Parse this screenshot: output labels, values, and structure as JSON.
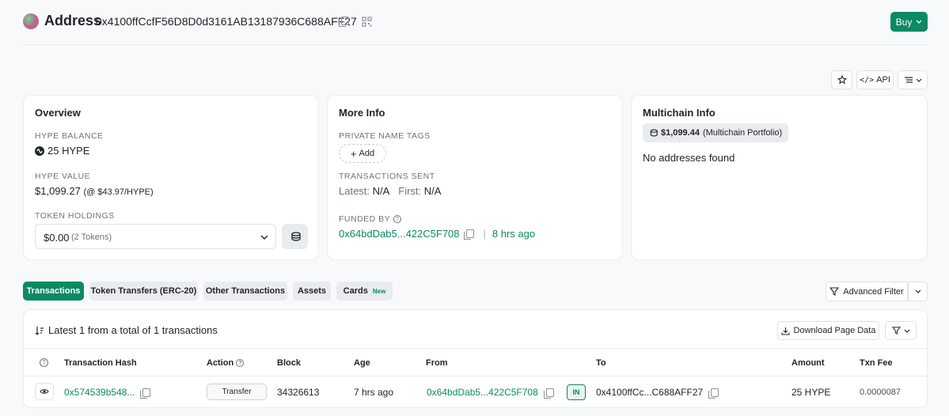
{
  "header": {
    "title": "Address",
    "address": "0x4100ffCcfF56D8D0d3161AB13187936C688AFF27",
    "buy_label": "Buy"
  },
  "toolbar": {
    "api_label": "API"
  },
  "overview": {
    "title": "Overview",
    "balance_label": "HYPE BALANCE",
    "balance_value": "25 HYPE",
    "value_label": "HYPE VALUE",
    "value_amount": "$1,099.27",
    "value_rate": "(@ $43.97/HYPE)",
    "holdings_label": "TOKEN HOLDINGS",
    "holdings_amount": "$0.00",
    "holdings_count": "(2 Tokens)"
  },
  "more_info": {
    "title": "More Info",
    "tags_label": "PRIVATE NAME TAGS",
    "add_label": "Add",
    "tx_sent_label": "TRANSACTIONS SENT",
    "latest_label": "Latest:",
    "latest_value": "N/A",
    "first_label": "First:",
    "first_value": "N/A",
    "funded_label": "FUNDED BY",
    "funded_address": "0x64bdDab5...422C5F708",
    "funded_sep": "|",
    "funded_age": "8 hrs ago"
  },
  "multichain": {
    "title": "Multichain Info",
    "portfolio_value": "$1,099.44",
    "portfolio_label": "(Multichain Portfolio)",
    "empty_text": "No addresses found"
  },
  "tabs": [
    {
      "label": "Transactions",
      "active": true
    },
    {
      "label": "Token Transfers (ERC-20)"
    },
    {
      "label": "Other Transactions"
    },
    {
      "label": "Assets"
    },
    {
      "label": "Cards",
      "badge": "New"
    }
  ],
  "advanced_filter_label": "Advanced Filter",
  "tx_panel": {
    "summary": "Latest 1 from a total of 1 transactions",
    "download_label": "Download Page Data",
    "columns": {
      "hash": "Transaction Hash",
      "action": "Action",
      "block": "Block",
      "age": "Age",
      "from": "From",
      "to": "To",
      "amount": "Amount",
      "fee": "Txn Fee"
    },
    "rows": [
      {
        "hash": "0x574539b548...",
        "action": "Transfer",
        "block": "34326613",
        "age": "7 hrs ago",
        "from": "0x64bdDab5...422C5F708",
        "direction": "IN",
        "to": "0x4100ffCc...C688AFF27",
        "amount": "25 HYPE",
        "fee": "0.0000087"
      }
    ]
  },
  "colors": {
    "accent": "#0b8a63",
    "tab_bg": "#e9ecef"
  }
}
